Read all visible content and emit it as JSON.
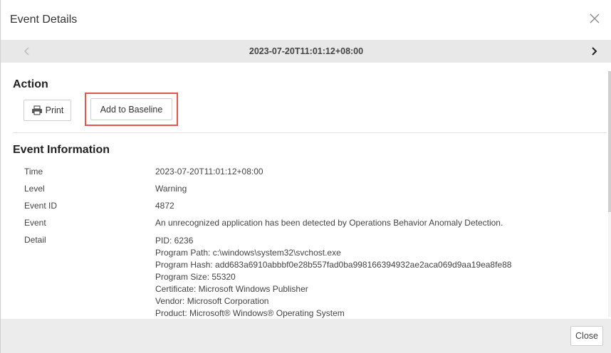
{
  "dialog": {
    "title": "Event Details"
  },
  "nav": {
    "date": "2023-07-20T11:01:12+08:00"
  },
  "action": {
    "heading": "Action",
    "print_label": "Print",
    "baseline_label": "Add to Baseline"
  },
  "event_info": {
    "heading": "Event Information",
    "rows": [
      {
        "label": "Time",
        "value": "2023-07-20T11:01:12+08:00"
      },
      {
        "label": "Level",
        "value": "Warning"
      },
      {
        "label": "Event ID",
        "value": "4872"
      },
      {
        "label": "Event",
        "value": "An unrecognized application has been detected by Operations Behavior Anomaly Detection."
      }
    ],
    "detail_label": "Detail",
    "detail_lines": [
      "PID: 6236",
      "Program Path: c:\\windows\\system32\\svchost.exe",
      "Program Hash: add683a6910abbbf0e28b557fad0ba998166394932ae2aca069d9aa19ea8fe88",
      "Program Size: 55320",
      "Certificate: Microsoft Windows Publisher",
      "Vendor: Microsoft Corporation",
      "Product: Microsoft® Windows® Operating System"
    ]
  },
  "footer": {
    "close_label": "Close"
  },
  "colors": {
    "highlight": "#e2564c",
    "nav_bg": "#e8e8e8",
    "footer_bg": "#ececec"
  }
}
